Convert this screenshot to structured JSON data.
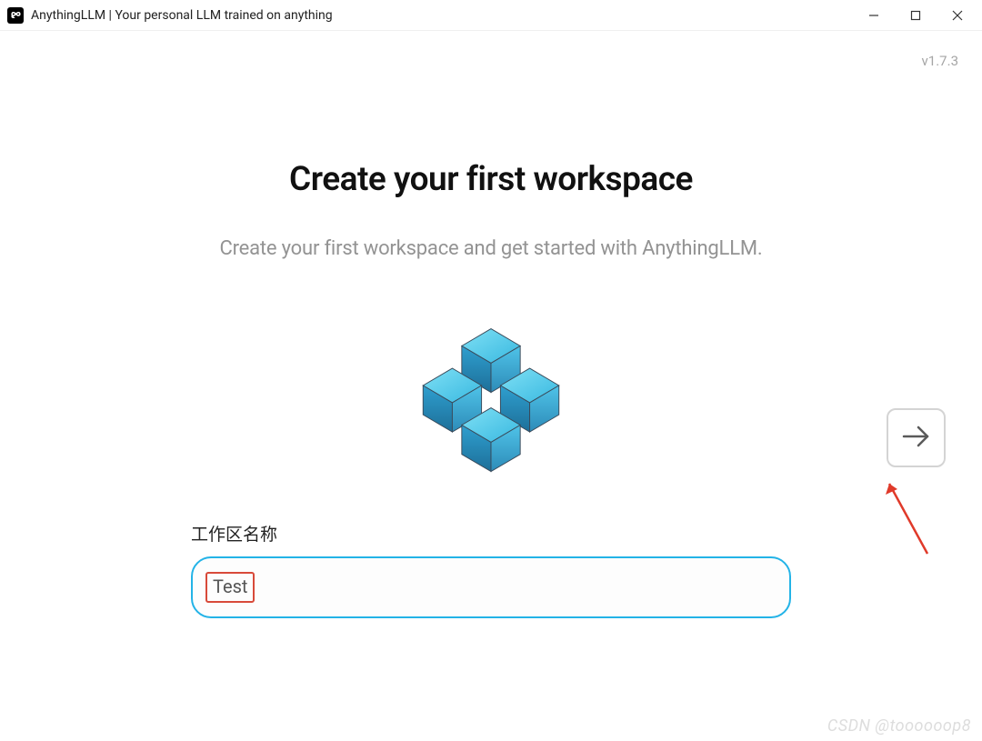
{
  "window": {
    "title": "AnythingLLM | Your personal LLM trained on anything"
  },
  "version": "v1.7.3",
  "onboarding": {
    "heading": "Create your first workspace",
    "subheading": "Create your first workspace and get started with AnythingLLM.",
    "input_label": "工作区名称",
    "input_value": "Test"
  },
  "watermark": "CSDN @toooooop8"
}
